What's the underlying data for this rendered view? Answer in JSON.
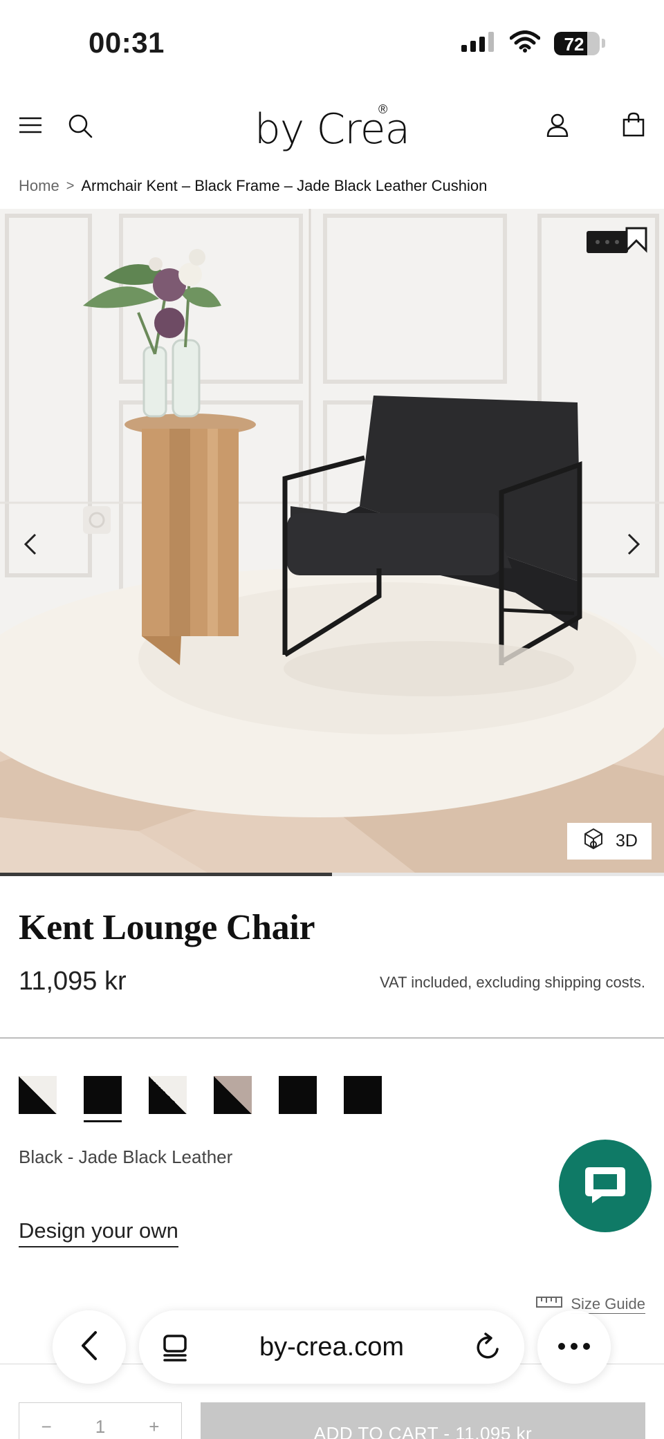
{
  "status_bar": {
    "time": "00:31",
    "battery_level": "72",
    "battery_fraction": 0.72
  },
  "header": {
    "logo": "by Crea",
    "logo_mark": "®"
  },
  "breadcrumb": {
    "home": "Home",
    "separator": ">",
    "current": "Armchair Kent – Black Frame – Jade Black Leather Cushion"
  },
  "gallery": {
    "badge_3d": "3D",
    "progress_fraction": 0.5
  },
  "product": {
    "title": "Kent Lounge Chair",
    "price": "11,095 kr",
    "vat_note": "VAT included, excluding shipping costs.",
    "variant_name": "Black - Jade Black Leather",
    "design_link": "Design your own",
    "size_guide": "Size Guide"
  },
  "swatches": [
    {
      "name": "white-black-diagonal",
      "colors": [
        "#f1efeb",
        "#0a0a0a"
      ]
    },
    {
      "name": "black",
      "colors": [
        "#0a0a0a",
        "#0a0a0a"
      ],
      "selected": true
    },
    {
      "name": "white-black-diagonal-2",
      "colors": [
        "#f1efeb",
        "#0a0a0a"
      ]
    },
    {
      "name": "taupe-black-diagonal",
      "colors": [
        "#b9a8a0",
        "#0a0a0a"
      ]
    },
    {
      "name": "black-2",
      "colors": [
        "#0a0a0a",
        "#0a0a0a"
      ]
    },
    {
      "name": "black-3",
      "colors": [
        "#0a0a0a",
        "#0a0a0a"
      ]
    }
  ],
  "cart": {
    "qty_minus": "−",
    "qty_value": "1",
    "qty_plus": "+",
    "add_to_cart": "ADD TO CART - 11,095 kr"
  },
  "browser": {
    "url": "by-crea.com"
  },
  "colors": {
    "chat_button": "#0f7a66",
    "progress": "#3a3a3a",
    "add_to_cart_bg": "#c7c7c7"
  }
}
